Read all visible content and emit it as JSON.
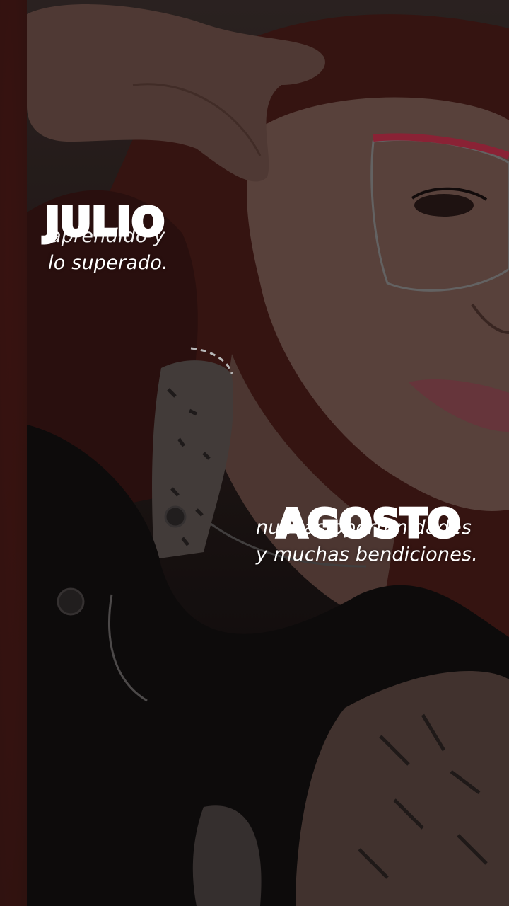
{
  "captions": {
    "julio_month": "JULIO",
    "julio_hidden_line": "aprendido y",
    "julio_line": "lo superado.",
    "agosto_month": "AGOSTO",
    "agosto_hidden_line": "nuevas oportunidades",
    "agosto_line": "y muchas bendiciones."
  },
  "colors": {
    "caption_text": "#ffffff",
    "glasses_frame": "#c0304a"
  }
}
